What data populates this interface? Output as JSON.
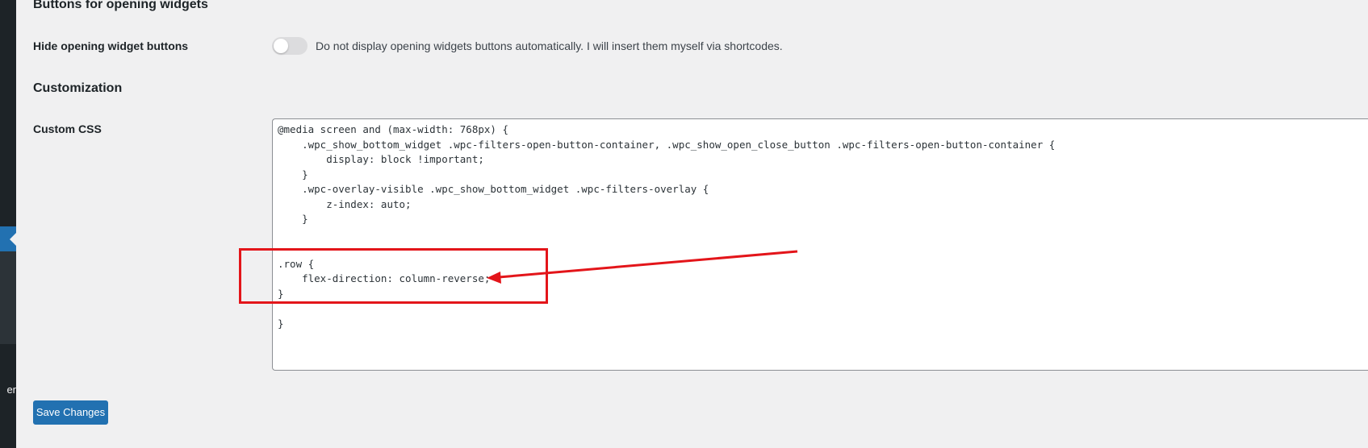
{
  "sidebar": {
    "cut_label": "er"
  },
  "sections": {
    "buttons_heading": "Buttons for opening widgets",
    "customization_heading": "Customization"
  },
  "hide_buttons": {
    "label": "Hide opening widget buttons",
    "description": "Do not display opening widgets buttons automatically. I will insert them myself via shortcodes.",
    "enabled": false
  },
  "custom_css": {
    "label": "Custom CSS",
    "value": "@media screen and (max-width: 768px) {\n    .wpc_show_bottom_widget .wpc-filters-open-button-container, .wpc_show_open_close_button .wpc-filters-open-button-container {\n        display: block !important;\n    }\n    .wpc-overlay-visible .wpc_show_bottom_widget .wpc-filters-overlay {\n        z-index: auto;\n    }\n\n\n.row {\n    flex-direction: column-reverse;\n}\n\n}"
  },
  "save_button": {
    "label": "Save Changes"
  },
  "colors": {
    "accent": "#2271b1",
    "annotation": "#e3151a",
    "background": "#f0f0f1",
    "sidebar": "#1d2327"
  }
}
